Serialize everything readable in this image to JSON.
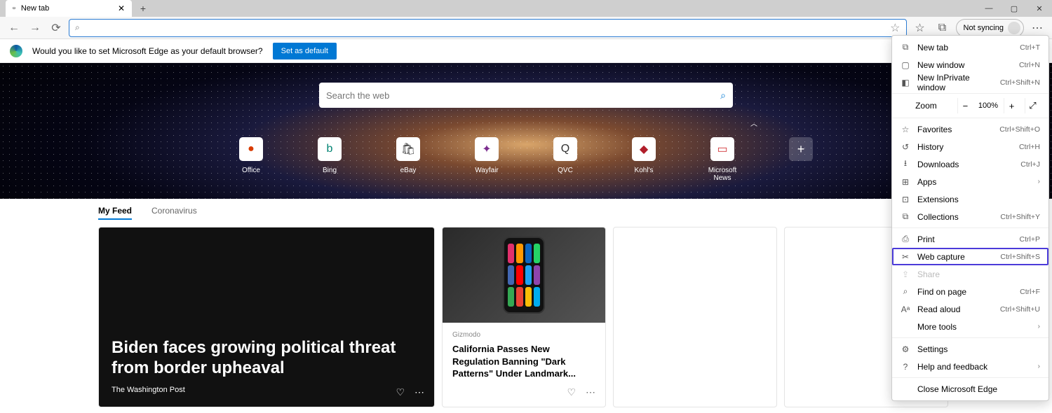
{
  "tab": {
    "title": "New tab"
  },
  "sync": {
    "label": "Not syncing"
  },
  "infobar": {
    "message": "Would you like to set Microsoft Edge as your default browser?",
    "button": "Set as default"
  },
  "search": {
    "placeholder": "Search the web"
  },
  "quicklinks": [
    {
      "label": "Office",
      "color": "#d83b01",
      "glyph": "●"
    },
    {
      "label": "Bing",
      "color": "#008373",
      "glyph": "b"
    },
    {
      "label": "eBay",
      "color": "#333",
      "glyph": "🛍"
    },
    {
      "label": "Wayfair",
      "color": "#7b2c8e",
      "glyph": "✦"
    },
    {
      "label": "QVC",
      "color": "#333",
      "glyph": "Q"
    },
    {
      "label": "Kohl's",
      "color": "#b11e2b",
      "glyph": "◆"
    },
    {
      "label": "Microsoft News",
      "color": "#d13438",
      "glyph": "▭"
    }
  ],
  "feed_tabs": [
    {
      "label": "My Feed",
      "active": true
    },
    {
      "label": "Coronavirus",
      "active": false
    }
  ],
  "cards": {
    "big": {
      "title": "Biden faces growing political threat from border upheaval",
      "source": "The Washington Post"
    },
    "small": {
      "source": "Gizmodo",
      "title": "California Passes New Regulation Banning \"Dark Patterns\" Under Landmark..."
    }
  },
  "menu": {
    "zoom_label": "Zoom",
    "zoom_value": "100%",
    "items": [
      {
        "icon": "⧉",
        "label": "New tab",
        "shortcut": "Ctrl+T"
      },
      {
        "icon": "▢",
        "label": "New window",
        "shortcut": "Ctrl+N"
      },
      {
        "icon": "◧",
        "label": "New InPrivate window",
        "shortcut": "Ctrl+Shift+N"
      }
    ],
    "items2": [
      {
        "icon": "☆",
        "label": "Favorites",
        "shortcut": "Ctrl+Shift+O"
      },
      {
        "icon": "↺",
        "label": "History",
        "shortcut": "Ctrl+H"
      },
      {
        "icon": "⭳",
        "label": "Downloads",
        "shortcut": "Ctrl+J"
      },
      {
        "icon": "⊞",
        "label": "Apps",
        "chevron": true
      },
      {
        "icon": "⊡",
        "label": "Extensions"
      },
      {
        "icon": "⧉",
        "label": "Collections",
        "shortcut": "Ctrl+Shift+Y"
      }
    ],
    "items3": [
      {
        "icon": "⎙",
        "label": "Print",
        "shortcut": "Ctrl+P"
      },
      {
        "icon": "✂",
        "label": "Web capture",
        "shortcut": "Ctrl+Shift+S",
        "highlight": true
      },
      {
        "icon": "⇪",
        "label": "Share",
        "disabled": true
      },
      {
        "icon": "⌕",
        "label": "Find on page",
        "shortcut": "Ctrl+F"
      },
      {
        "icon": "Aᵃ",
        "label": "Read aloud",
        "shortcut": "Ctrl+Shift+U"
      },
      {
        "icon": "",
        "label": "More tools",
        "chevron": true
      }
    ],
    "items4": [
      {
        "icon": "⚙",
        "label": "Settings"
      },
      {
        "icon": "?",
        "label": "Help and feedback",
        "chevron": true
      }
    ],
    "items5": [
      {
        "icon": "",
        "label": "Close Microsoft Edge"
      }
    ]
  }
}
